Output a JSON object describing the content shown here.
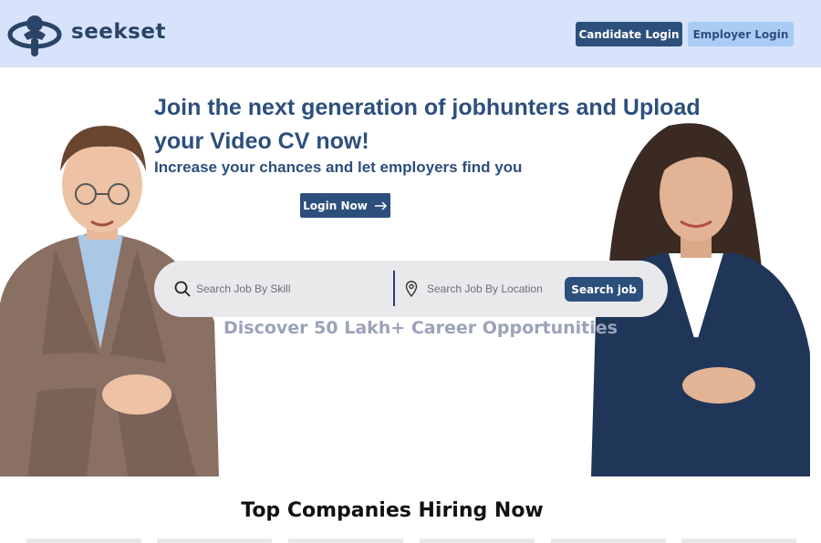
{
  "header": {
    "brand": "seekset",
    "candidate_login": "Candidate Login",
    "employer_login": "Employer Login"
  },
  "hero": {
    "title": "Join the next generation of jobhunters and Upload your Video CV now!",
    "subtitle": "Increase your chances and let employers find you",
    "login_now": "Login Now"
  },
  "search": {
    "skill_placeholder": "Search Job By Skill",
    "location_placeholder": "Search Job By Location",
    "button": "Search job"
  },
  "discover": "Discover 50 Lakh+ Career Opportunities",
  "companies": {
    "title": "Top Companies Hiring Now",
    "tile_count": 6
  },
  "colors": {
    "header_bg": "#d6e3fa",
    "primary": "#2d4f7c",
    "secondary_button": "#a9ccf5",
    "muted_text": "#9aa3b8"
  },
  "icons": [
    "seekset-logo-icon",
    "arrow-right-icon",
    "search-icon",
    "location-pin-icon"
  ]
}
